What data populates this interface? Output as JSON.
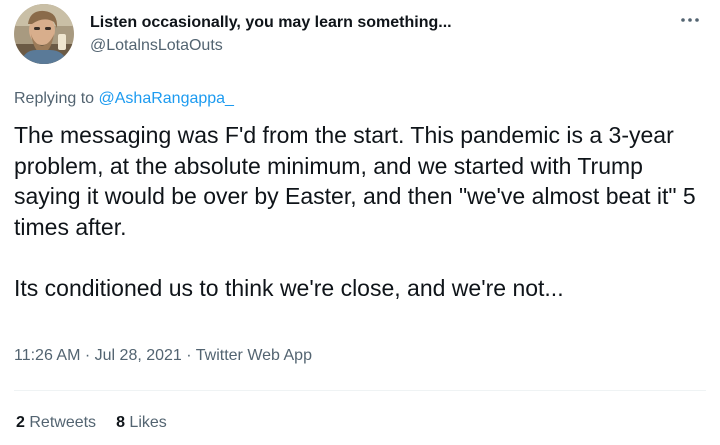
{
  "tweet": {
    "author": {
      "display_name": "Listen occasionally, you may learn something...",
      "handle": "@LotalnsLotaOuts"
    },
    "more_icon": "more-horizontal-icon",
    "reply": {
      "prefix": "Replying to ",
      "mention": "@AshaRangappa_"
    },
    "text": {
      "paragraph_1": "The messaging was F'd from the start. This pandemic is a 3-year problem, at the absolute minimum, and we started with Trump saying it would be over by Easter, and then \"we've almost beat it\" 5 times after.",
      "paragraph_2": "Its conditioned us to think we're close, and we're not..."
    },
    "meta": {
      "time": "11:26 AM",
      "separator": " · ",
      "date": "Jul 28, 2021",
      "source": "Twitter Web App"
    },
    "stats": {
      "retweets_count": "2",
      "retweets_label": "Retweets",
      "likes_count": "8",
      "likes_label": "Likes"
    },
    "colors": {
      "link": "#1d9bf0",
      "secondary_text": "#536471",
      "primary_text": "#0f1419",
      "divider": "#eff3f4"
    }
  }
}
